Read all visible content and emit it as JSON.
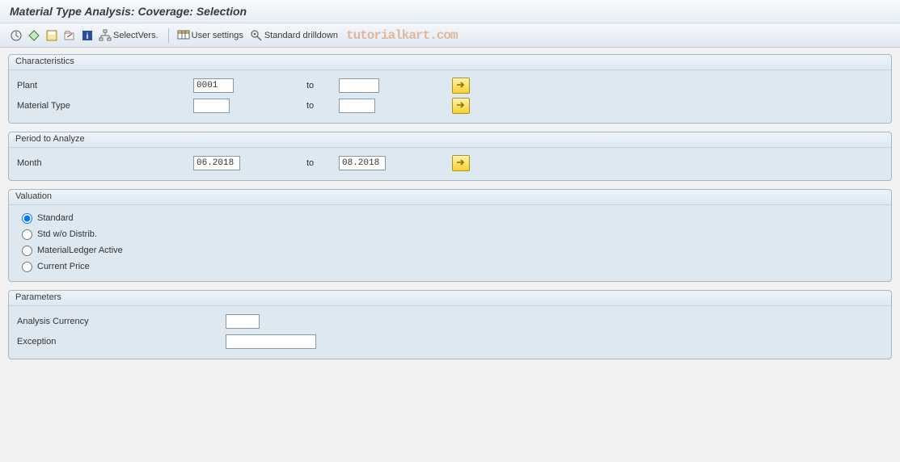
{
  "title": "Material Type Analysis: Coverage: Selection",
  "toolbar": {
    "select_vers": "SelectVers.",
    "user_settings": "User settings",
    "std_drilldown": "Standard drilldown"
  },
  "watermark": "tutorialkart.com",
  "panels": {
    "characteristics": {
      "legend": "Characteristics",
      "plant_label": "Plant",
      "plant_from": "0001",
      "plant_to": "",
      "to_label": "to",
      "mtype_label": "Material Type",
      "mtype_from": "",
      "mtype_to": ""
    },
    "period": {
      "legend": "Period to Analyze",
      "month_label": "Month",
      "month_from": "06.2018",
      "to_label": "to",
      "month_to": "08.2018"
    },
    "valuation": {
      "legend": "Valuation",
      "opt_standard": "Standard",
      "opt_std_wo": "Std w/o Distrib.",
      "opt_ml": "MaterialLedger Active",
      "opt_curr": "Current Price"
    },
    "parameters": {
      "legend": "Parameters",
      "currency_label": "Analysis Currency",
      "currency_val": "",
      "exception_label": "Exception",
      "exception_val": ""
    }
  }
}
